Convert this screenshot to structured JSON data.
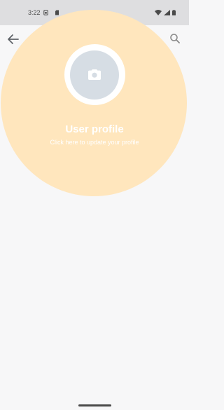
{
  "status_bar": {
    "time": "3:22",
    "icons": [
      "sim-icon",
      "battery-saver-icon",
      "wifi-icon",
      "signal-icon",
      "battery-icon"
    ]
  },
  "app_bar": {
    "back_icon": "arrow-left-icon",
    "search_icon": "search-icon"
  },
  "profile": {
    "title": "User profile",
    "subtitle": "Click here to update your profile",
    "avatar_icon": "camera-icon"
  },
  "colors": {
    "header_circle": "#ffe6bd",
    "avatar_bg": "#d6dde4",
    "page_bg": "#f7f7f8",
    "status_bar_bg": "#dedee0"
  }
}
